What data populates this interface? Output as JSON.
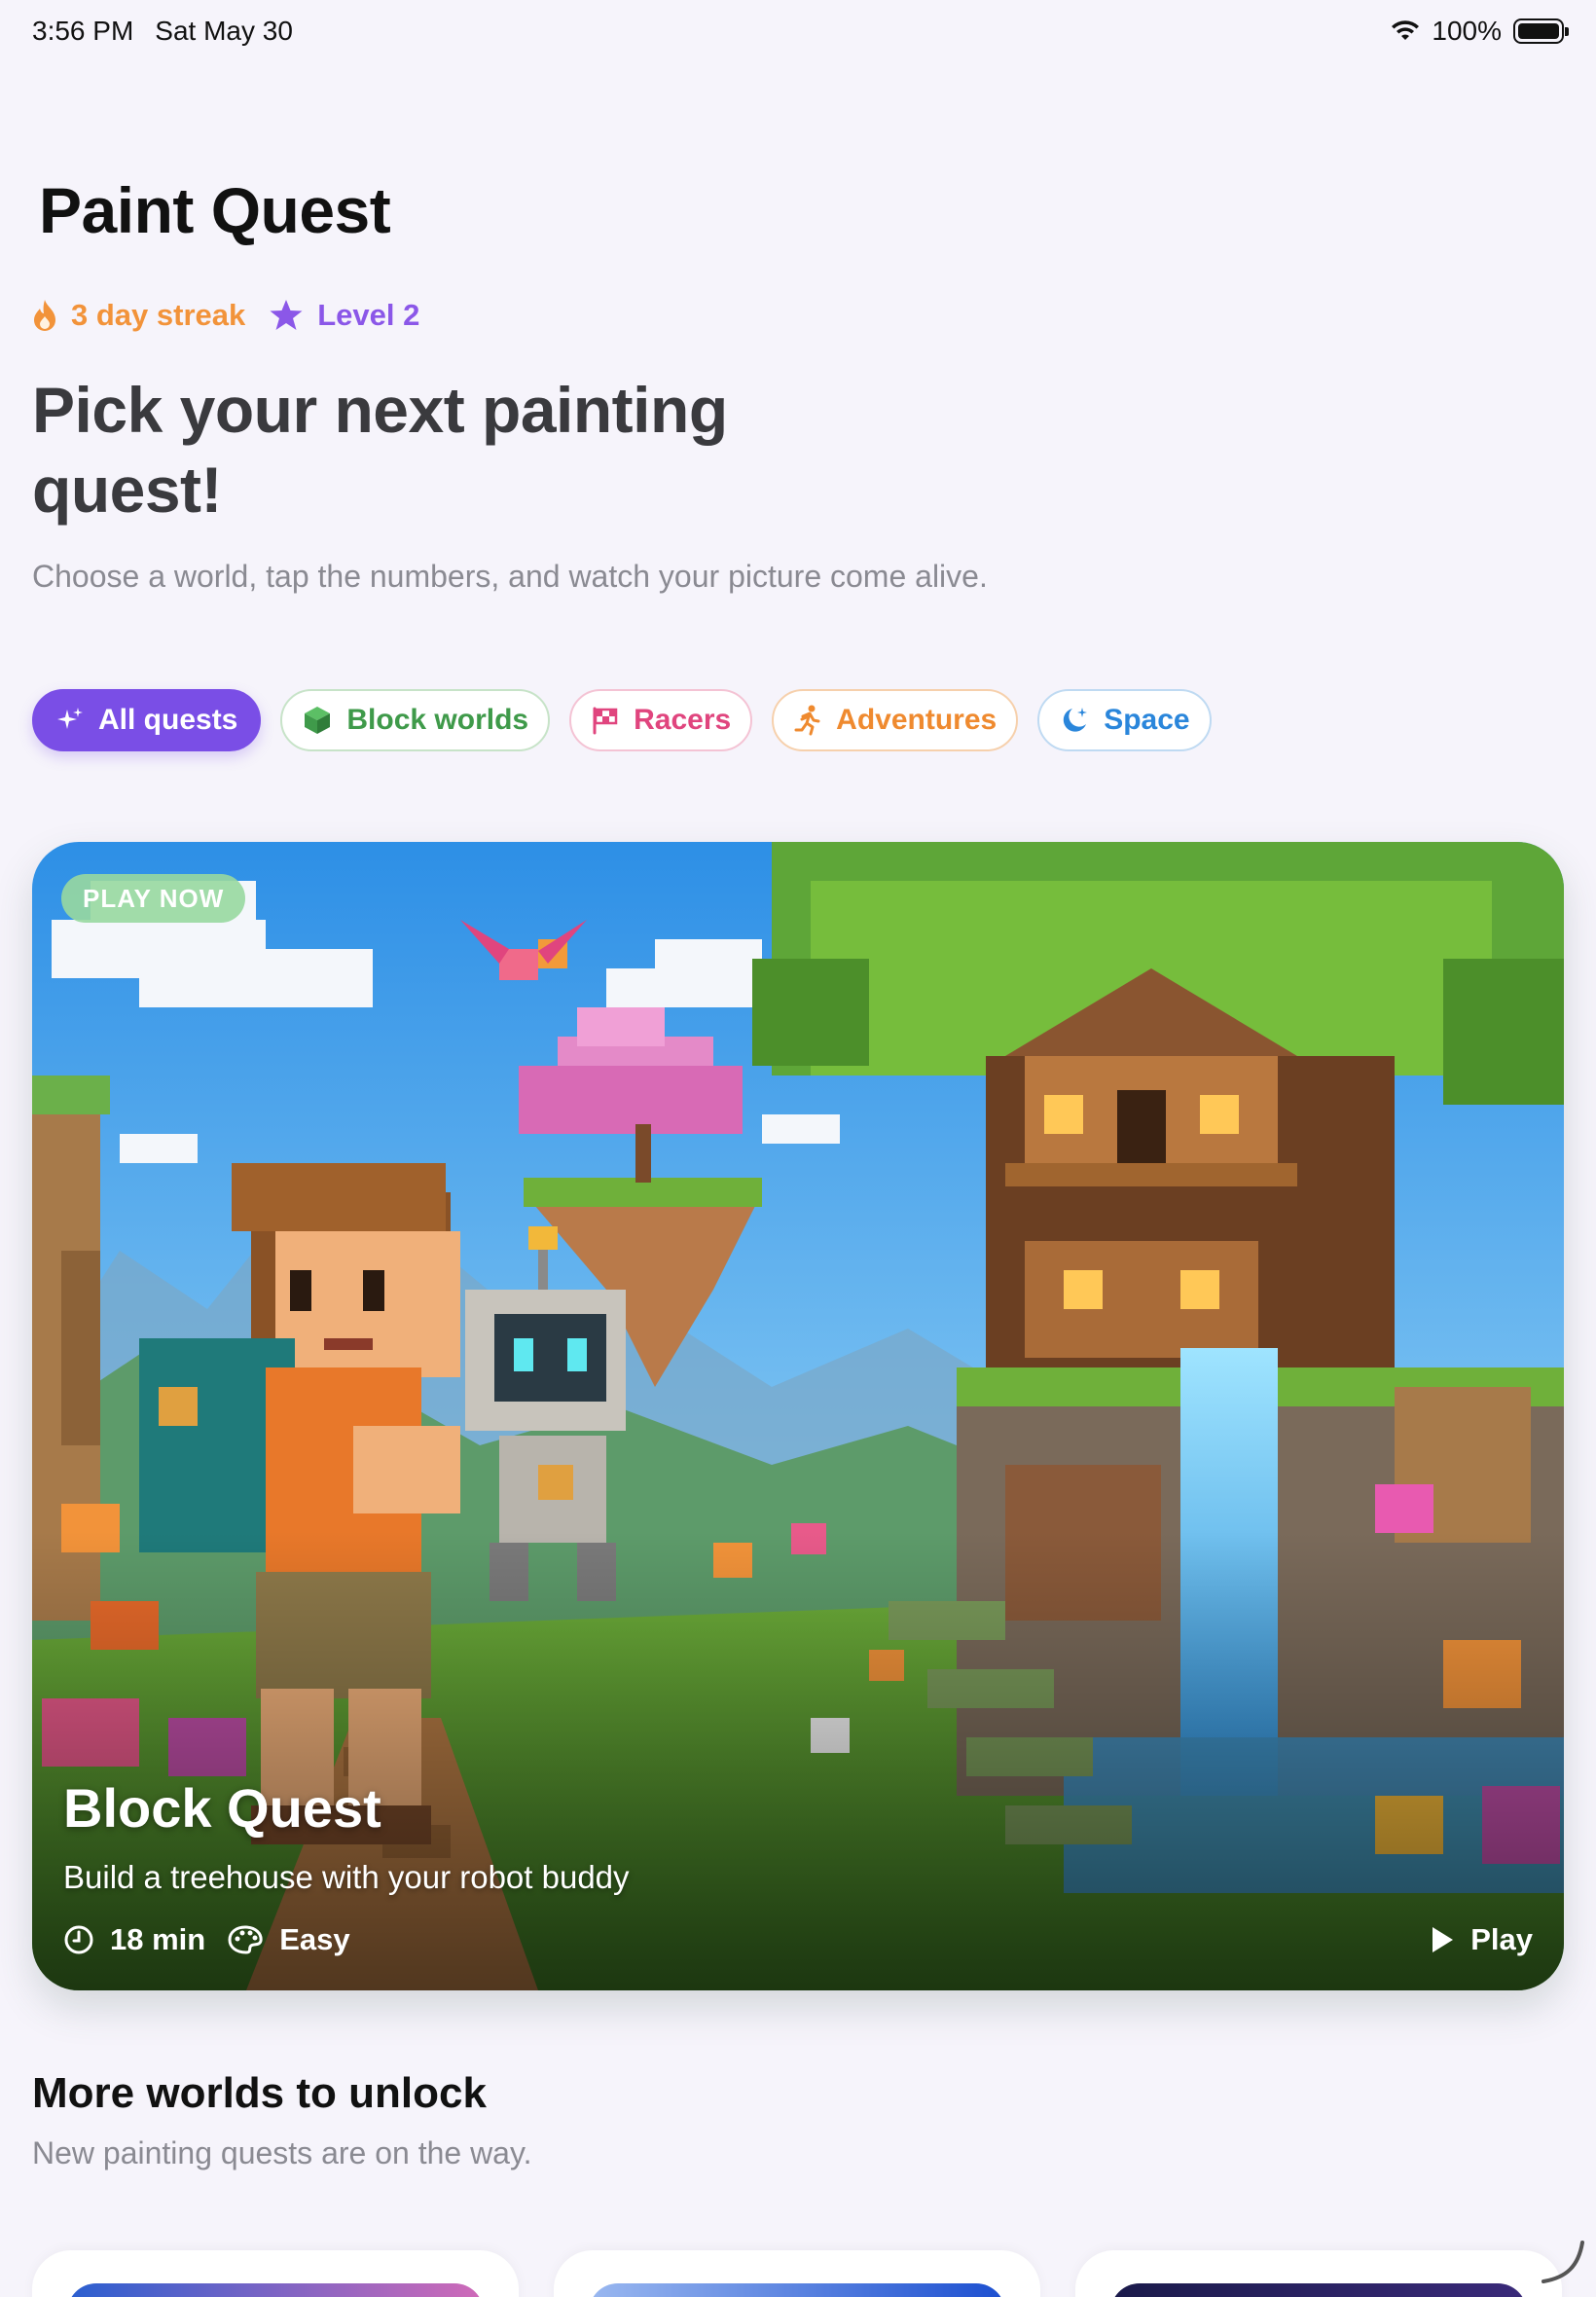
{
  "status_bar": {
    "time": "3:56 PM",
    "date": "Sat May 30",
    "battery": "100%"
  },
  "app": {
    "title": "Paint Quest"
  },
  "stats": {
    "streak": "3 day streak",
    "level": "Level 2"
  },
  "header": {
    "headline": "Pick your next painting quest!",
    "subtitle": "Choose a world, tap the numbers, and watch your picture come alive."
  },
  "filters": [
    {
      "label": "All quests",
      "icon": "sparkles-icon",
      "color": "#7a4ee6",
      "selected": true
    },
    {
      "label": "Block worlds",
      "icon": "cube-icon",
      "color": "#3f9a4a"
    },
    {
      "label": "Racers",
      "icon": "checkered-flag-icon",
      "color": "#e0457e"
    },
    {
      "label": "Adventures",
      "icon": "running-figure-icon",
      "color": "#ef8a2f"
    },
    {
      "label": "Space",
      "icon": "moon-star-icon",
      "color": "#2a86db"
    }
  ],
  "featured": {
    "badge": "PLAY NOW",
    "title": "Block Quest",
    "description": "Build a treehouse with your robot buddy",
    "duration": "18 min",
    "difficulty": "Easy",
    "action": "Play"
  },
  "more": {
    "title": "More worlds to unlock",
    "subtitle": "New painting quests are on the way."
  }
}
